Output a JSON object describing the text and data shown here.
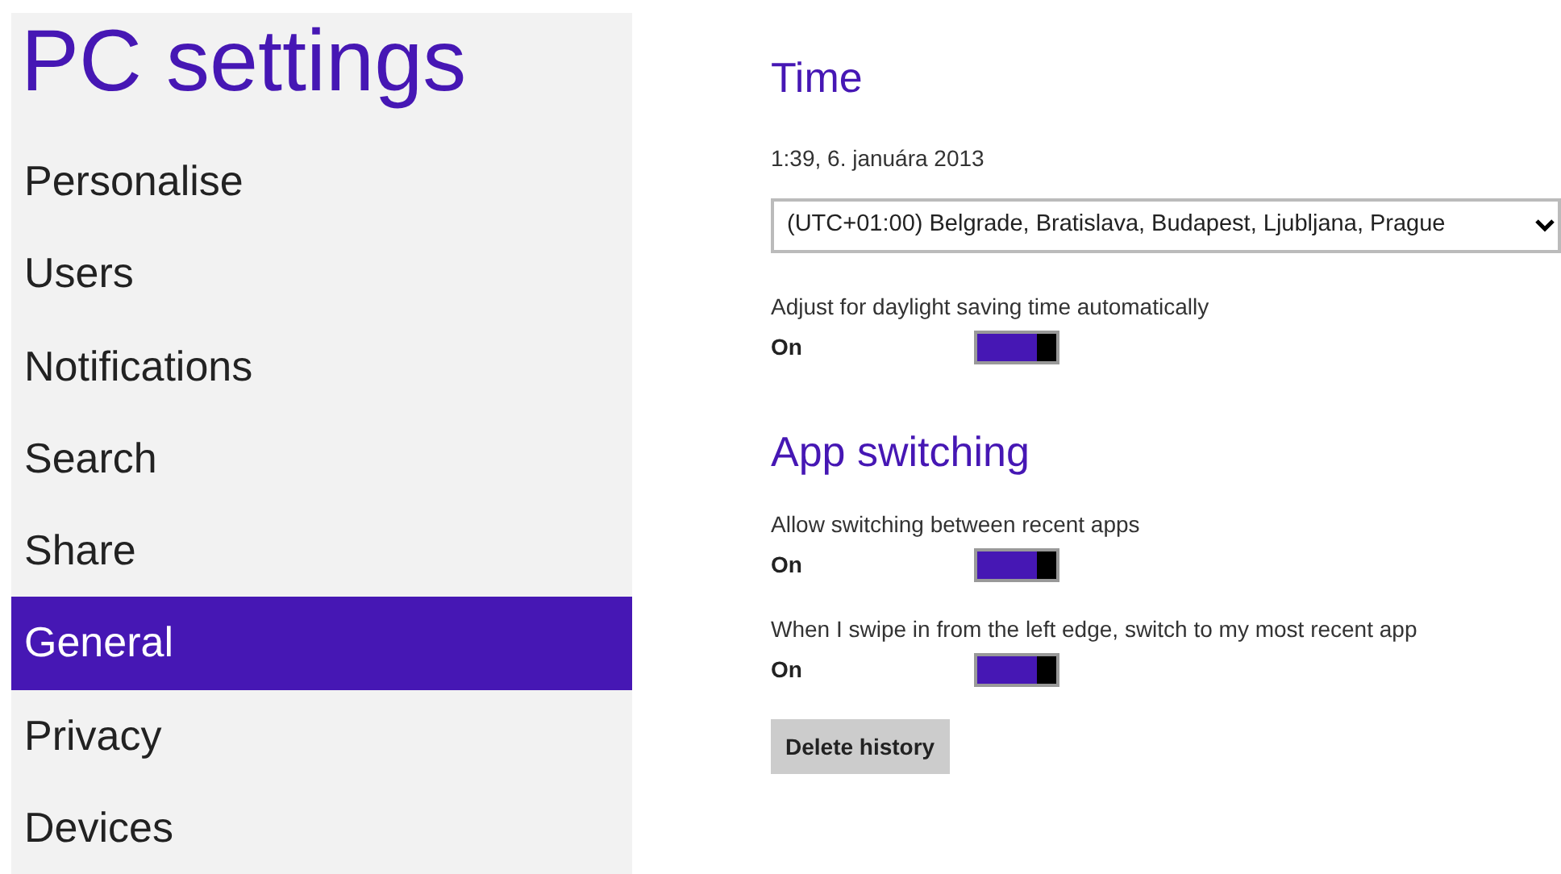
{
  "title": "PC settings",
  "sidebar": {
    "items": [
      {
        "label": "Personalise",
        "selected": false
      },
      {
        "label": "Users",
        "selected": false
      },
      {
        "label": "Notifications",
        "selected": false
      },
      {
        "label": "Search",
        "selected": false
      },
      {
        "label": "Share",
        "selected": false
      },
      {
        "label": "General",
        "selected": true
      },
      {
        "label": "Privacy",
        "selected": false
      },
      {
        "label": "Devices",
        "selected": false
      }
    ]
  },
  "sections": [
    {
      "title": "Time",
      "items": [
        {
          "kind": "text",
          "text": "1:39, 6. januára 2013"
        },
        {
          "kind": "select",
          "value": "(UTC+01:00) Belgrade, Bratislava, Budapest, Ljubljana, Prague"
        },
        {
          "kind": "toggle",
          "label": "Adjust for daylight saving time automatically",
          "state": "On",
          "on": true
        }
      ]
    },
    {
      "title": "App switching",
      "items": [
        {
          "kind": "toggle",
          "label": "Allow switching between recent apps",
          "state": "On",
          "on": true
        },
        {
          "kind": "toggle",
          "label": "When I swipe in from the left edge, switch to my most recent app",
          "state": "On",
          "on": true
        },
        {
          "kind": "button",
          "label": "Delete history"
        }
      ]
    }
  ]
}
